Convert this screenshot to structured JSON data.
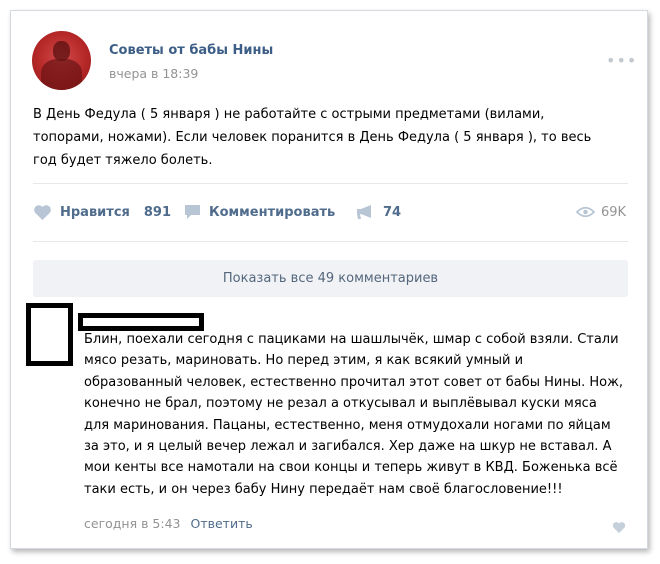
{
  "post": {
    "author": "Советы от бабы Нины",
    "time": "вчера в 18:39",
    "more_icon": "•••",
    "text": "В День Федула ( 5 января ) не работайте с острыми предметами (вилами, топорами, ножами). Если человек поранится в День Федула ( 5 января ), то весь год будет тяжело болеть."
  },
  "actions": {
    "like_label": "Нравится",
    "like_count": "891",
    "comment_label": "Комментировать",
    "share_count": "74",
    "views": "69K"
  },
  "comments": {
    "show_all": "Показать все 49 комментариев",
    "items": [
      {
        "text": "Блин, поехали сегодня с пациками на шашлычёк, шмар с собой взяли. Стали мясо резать, мариновать. Но перед этим, я как всякий умный и образованный человек, естественно прочитал этот совет от бабы Нины. Нож, конечно не брал, поэтому не резал а откусывал и выплёвывал куски мяса для маринования. Пацаны, естественно, меня отмудохали ногами по яйцам за это, и я целый вечер лежал и загибался. Хер даже на шкур не вставал. А мои кенты все намотали на свои концы и теперь живут в КВД. Боженька всё таки есть, и он через бабу Нину передаёт нам своё благословение!!!",
        "time": "сегодня в 5:43",
        "reply_label": "Ответить"
      }
    ]
  },
  "colors": {
    "link": "#3c5e86",
    "action": "#4f6c8c",
    "muted": "#939393",
    "icon": "#b7c5d4"
  }
}
